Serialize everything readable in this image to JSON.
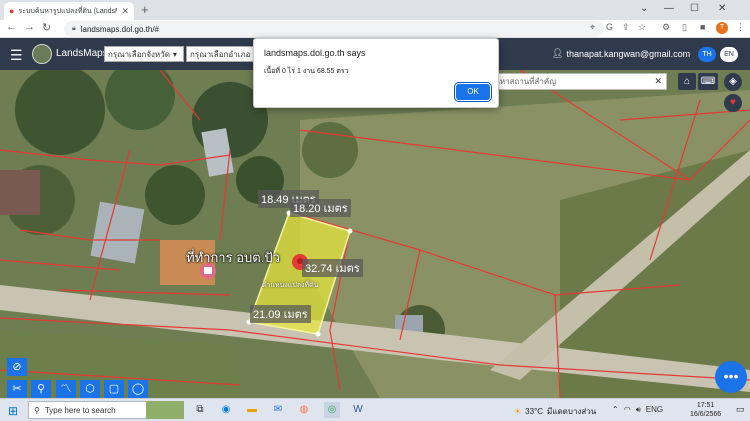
{
  "browser": {
    "tab_title": "ระบบค้นหารูปแปลงที่ดิน (LandsMaps...",
    "new_tab": "+",
    "url": "landsmaps.dol.go.th/#",
    "profile_initial": "T",
    "window_controls": [
      "⌄",
      "—",
      "☐",
      "✕"
    ]
  },
  "app": {
    "brand": "LandsMaps",
    "province_select": "กรุณาเลือกจังหวัด",
    "district_select": "กรุณาเลือกอำเภอ",
    "user_email": "thanapat.kangwan@gmail.com",
    "lang_th": "TH",
    "lang_en": "EN",
    "search_placeholder": "ค้นหาสถานที่สำคัญ"
  },
  "dialog": {
    "title": "landsmaps.dol.go.th says",
    "message": "เนื้อที่ 0 ไร่ 1 งาน 68.55 ตรว",
    "ok_label": "OK"
  },
  "map": {
    "measure_top_left": "18.49 เมตร",
    "measure_top": "18.20 เมตร",
    "measure_right": "32.74 เมตร",
    "measure_bottom": "21.09 เมตร",
    "place_title": "ที่ทำการ อบต.ปัว",
    "pin_caption": "ตำแหน่งแปลงที่ดิน",
    "parcel_color": "#e8e83a",
    "boundary_color": "#e53935"
  },
  "taskbar": {
    "search_placeholder": "Type here to search",
    "temperature": "33°C",
    "weather_text": "มีแดดบางส่วน",
    "language": "ENG",
    "time": "17:51",
    "date": "16/6/2566"
  }
}
